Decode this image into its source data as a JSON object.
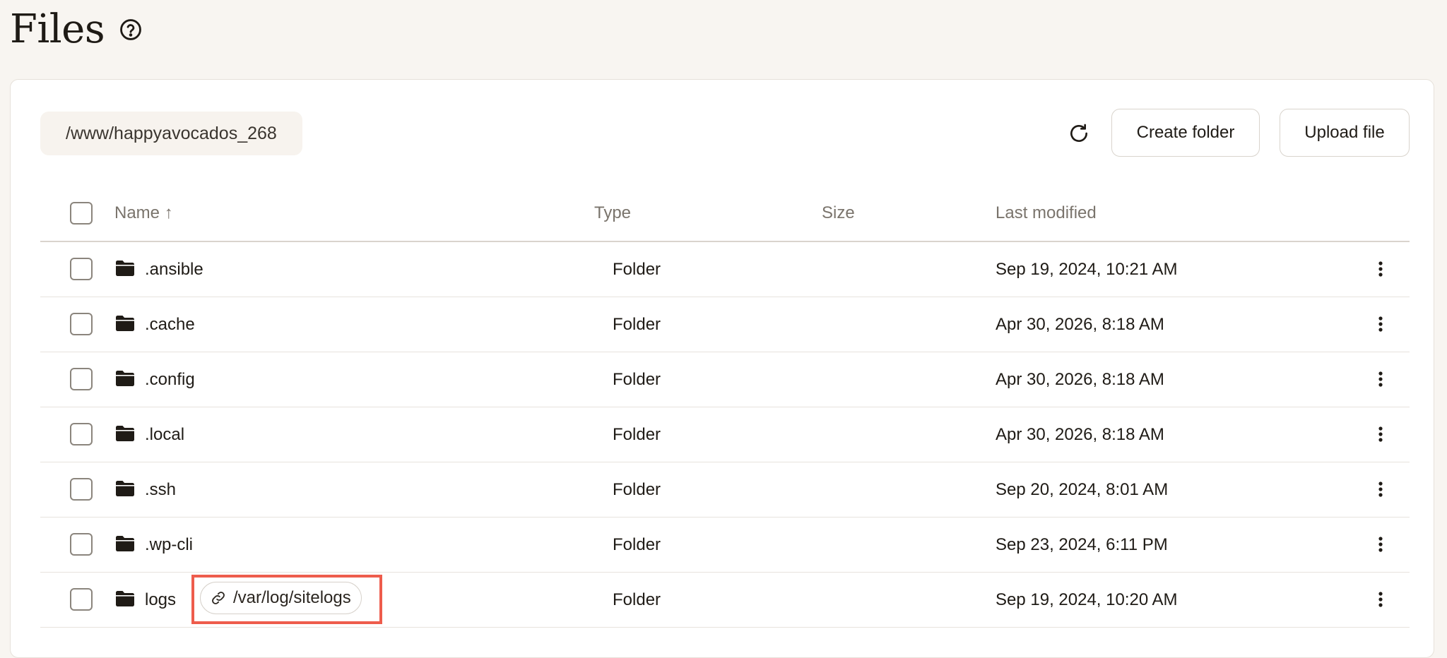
{
  "header": {
    "title": "Files",
    "help_icon": "help-circle-icon"
  },
  "toolbar": {
    "path": "/www/happyavocados_268",
    "refresh_icon": "refresh-icon",
    "create_folder_label": "Create folder",
    "upload_file_label": "Upload file"
  },
  "table": {
    "columns": {
      "name": "Name ↑",
      "type": "Type",
      "size": "Size",
      "modified": "Last modified"
    },
    "rows": [
      {
        "name": ".ansible",
        "type": "Folder",
        "size": "",
        "modified": "Sep 19, 2024, 10:21 AM"
      },
      {
        "name": ".cache",
        "type": "Folder",
        "size": "",
        "modified": "Apr 30, 2026, 8:18 AM"
      },
      {
        "name": ".config",
        "type": "Folder",
        "size": "",
        "modified": "Apr 30, 2026, 8:18 AM"
      },
      {
        "name": ".local",
        "type": "Folder",
        "size": "",
        "modified": "Apr 30, 2026, 8:18 AM"
      },
      {
        "name": ".ssh",
        "type": "Folder",
        "size": "",
        "modified": "Sep 20, 2024, 8:01 AM"
      },
      {
        "name": ".wp-cli",
        "type": "Folder",
        "size": "",
        "modified": "Sep 23, 2024, 6:11 PM"
      },
      {
        "name": "logs",
        "type": "Folder",
        "size": "",
        "modified": "Sep 19, 2024, 10:20 AM",
        "symlink": "/var/log/sitelogs"
      }
    ]
  },
  "colors": {
    "highlight": "#ee5c4c",
    "background": "#f8f5f1"
  }
}
